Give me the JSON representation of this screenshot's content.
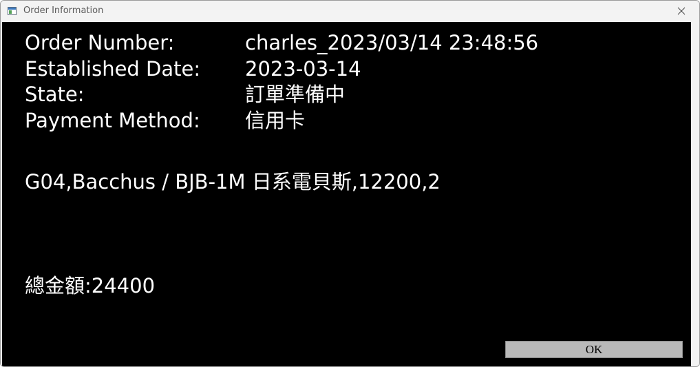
{
  "window": {
    "title": "Order Information",
    "close_glyph": "close-icon"
  },
  "order": {
    "fields": [
      {
        "label": "Order Number:",
        "value": "charles_2023/03/14 23:48:56"
      },
      {
        "label": "Established Date:",
        "value": "2023-03-14"
      },
      {
        "label": "State:",
        "value": "訂單準備中"
      },
      {
        "label": "Payment Method:",
        "value": "信用卡"
      }
    ],
    "item_line": "G04,Bacchus / BJB-1M 日系電貝斯,12200,2",
    "total_line": "總金額:24400"
  },
  "buttons": {
    "ok_label": "OK"
  },
  "colors": {
    "content_background": "#000000",
    "text": "#ffffff",
    "titlebar": "#f3f3f3",
    "button_face": "#b9b9b9"
  }
}
